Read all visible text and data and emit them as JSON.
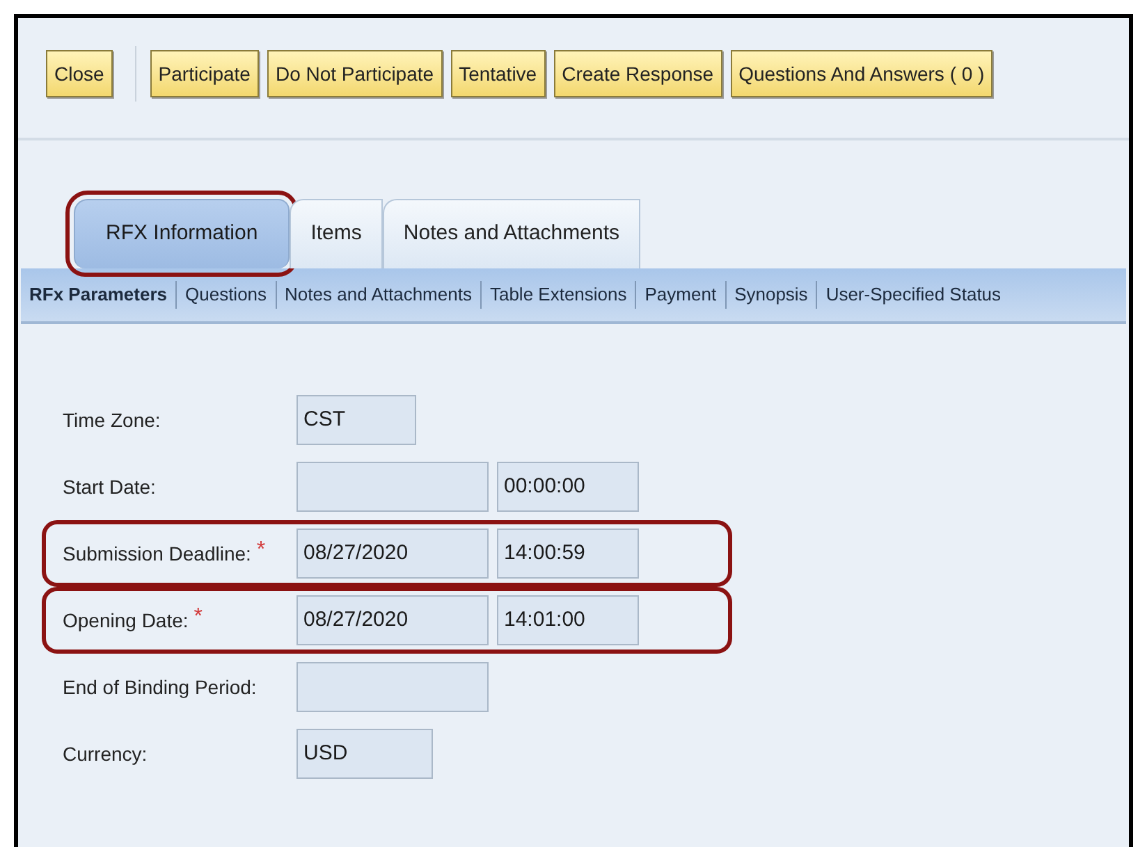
{
  "toolbar": {
    "groups": [
      [
        {
          "label": "Close"
        }
      ],
      [
        {
          "label": "Participate"
        },
        {
          "label": "Do Not Participate"
        },
        {
          "label": "Tentative"
        },
        {
          "label": "Create Response"
        },
        {
          "label": "Questions And Answers ( 0 )"
        }
      ]
    ]
  },
  "tabs": [
    {
      "label": "RFX Information",
      "selected": true,
      "highlighted": true
    },
    {
      "label": "Items",
      "selected": false,
      "highlighted": false
    },
    {
      "label": "Notes and Attachments",
      "selected": false,
      "highlighted": false
    }
  ],
  "subtabs": [
    {
      "label": "RFx Parameters",
      "selected": true
    },
    {
      "label": "Questions",
      "selected": false
    },
    {
      "label": "Notes and Attachments",
      "selected": false
    },
    {
      "label": "Table Extensions",
      "selected": false
    },
    {
      "label": "Payment",
      "selected": false
    },
    {
      "label": "Synopsis",
      "selected": false
    },
    {
      "label": "User-Specified Status",
      "selected": false
    }
  ],
  "form": {
    "fields": [
      {
        "label": "Time Zone:",
        "highlighted": false,
        "kind": "short",
        "value": "CST"
      },
      {
        "label": "Start Date:",
        "highlighted": false,
        "kind": "datetime",
        "time": "00:00:00"
      },
      {
        "label": "Submission Deadline:",
        "required_mark": "*",
        "highlighted": true,
        "kind": "datetime",
        "value": "08/27/2020",
        "time": "14:00:59"
      },
      {
        "label": "Opening Date:",
        "required_mark": "*",
        "highlighted": true,
        "kind": "datetime",
        "value": "08/27/2020",
        "time": "14:01:00"
      },
      {
        "label": "End of Binding Period:",
        "highlighted": false,
        "kind": "date"
      },
      {
        "label": "Currency:",
        "highlighted": false,
        "kind": "medium",
        "value": "USD"
      }
    ]
  }
}
